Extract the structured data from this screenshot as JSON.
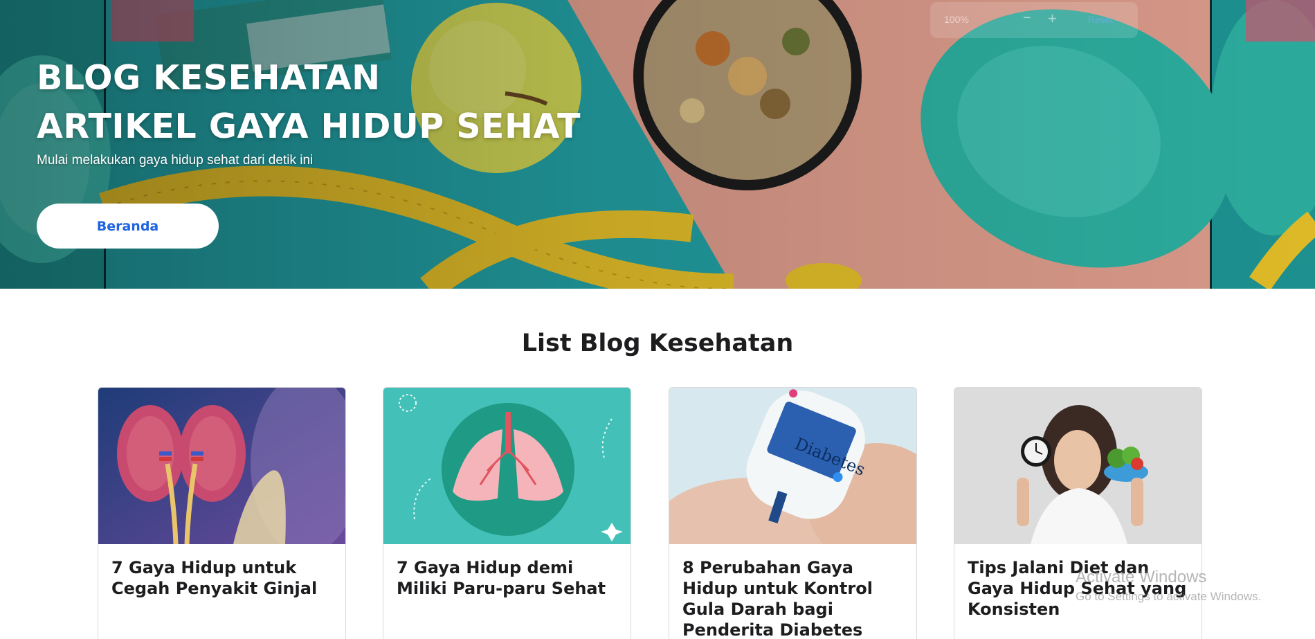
{
  "hero": {
    "title_line1": "BLOG KESEHATAN",
    "title_line2": "ARTIKEL GAYA HIDUP SEHAT",
    "subtitle": "Mulai melakukan gaya hidup sehat dari detik ini",
    "button_label": "Beranda",
    "image_icon": "fitness-food-photo"
  },
  "zoom": {
    "value": "100%",
    "minus": "−",
    "plus": "+",
    "reset": "Reset"
  },
  "section": {
    "title": "List Blog Kesehatan"
  },
  "cards": [
    {
      "title": "7 Gaya Hidup untuk Cegah Penyakit Ginjal",
      "image_icon": "kidney-illustration"
    },
    {
      "title": "7 Gaya Hidup demi Miliki Paru-paru Sehat",
      "image_icon": "lungs-illustration"
    },
    {
      "title": "8 Perubahan Gaya Hidup untuk Kontrol Gula Darah bagi Penderita Diabetes",
      "image_icon": "glucose-meter-photo",
      "image_text": "Diabetes"
    },
    {
      "title": "Tips Jalani Diet dan Gaya Hidup Sehat yang Konsisten",
      "image_icon": "woman-clock-salad-photo"
    }
  ],
  "watermark": {
    "line1": "Activate Windows",
    "line2": "Go to Settings to activate Windows."
  },
  "colors": {
    "accent": "#1f63e0",
    "teal": "#2aa6a6",
    "text_dark": "#1d1d1f"
  }
}
